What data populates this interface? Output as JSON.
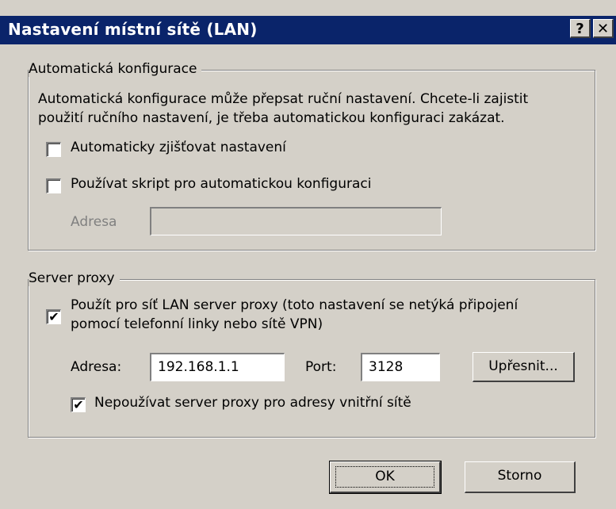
{
  "window": {
    "title": "Nastavení místní sítě (LAN)",
    "help_label": "?",
    "close_label": "✕"
  },
  "auto": {
    "legend": "Automatická konfigurace",
    "description_line1": "Automatická konfigurace může přepsat ruční nastavení. Chcete-li zajistit",
    "description_line2": "použití ručního nastavení, je třeba automatickou konfiguraci zakázat.",
    "detect_label": "Automaticky zjišťovat nastavení",
    "detect_checked": false,
    "script_label": "Používat skript pro automatickou konfiguraci",
    "script_checked": false,
    "address_label": "Adresa",
    "address_value": ""
  },
  "proxy": {
    "legend": "Server proxy",
    "use_label_line1": "Použít pro síť LAN server proxy (toto nastavení se netýká připojení",
    "use_label_line2": "pomocí telefonní linky nebo sítě VPN)",
    "use_checked": true,
    "address_label": "Adresa:",
    "address_value": "192.168.1.1",
    "port_label": "Port:",
    "port_value": "3128",
    "advanced_label": "Upřesnit...",
    "bypass_label": "Nepoužívat server proxy pro adresy vnitřní sítě",
    "bypass_checked": true,
    "check_mark": "✔"
  },
  "buttons": {
    "ok": "OK",
    "cancel": "Storno"
  },
  "colors": {
    "titlebar": "#0a246a",
    "face": "#d4d0c8"
  }
}
